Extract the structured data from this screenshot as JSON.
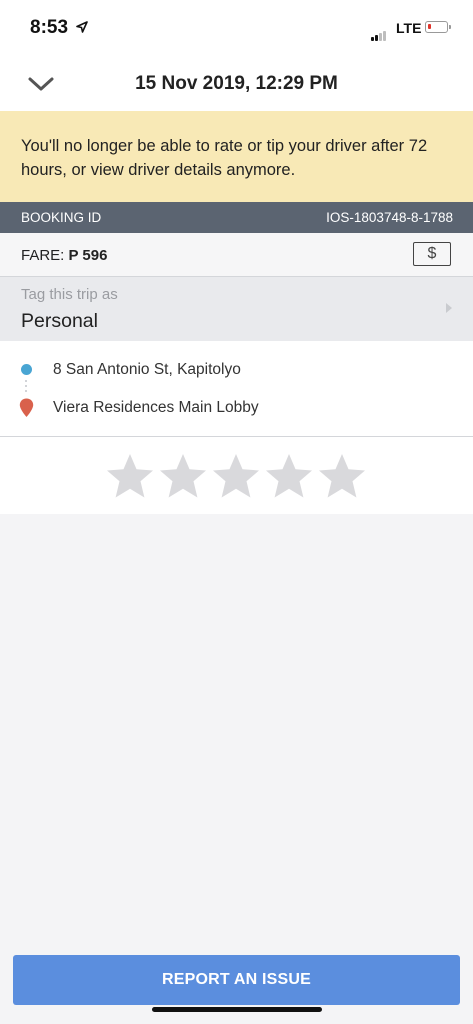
{
  "status_bar": {
    "time": "8:53",
    "network": "LTE",
    "icons": [
      "location-arrow-icon",
      "signal-icon",
      "battery-icon"
    ]
  },
  "header": {
    "title": "15 Nov 2019, 12:29 PM",
    "back_icon": "chevron-down-icon"
  },
  "notice": {
    "text": "You'll no longer be able to rate or tip your driver after 72 hours, or view driver details anymore."
  },
  "booking": {
    "label": "BOOKING ID",
    "id": "IOS-1803748-8-1788"
  },
  "fare": {
    "label": "FARE:",
    "amount": "P 596",
    "receipt_symbol": "$"
  },
  "tag": {
    "hint": "Tag this trip as",
    "value": "Personal",
    "icon": "chevron-right-icon"
  },
  "route": {
    "pickup": "8 San Antonio St, Kapitolyo",
    "dropoff": "Viera Residences Main Lobby"
  },
  "rating": {
    "max_stars": 5,
    "selected": 0
  },
  "actions": {
    "report_label": "REPORT AN ISSUE"
  },
  "colors": {
    "notice_bg": "#f8e9b6",
    "booking_bar": "#5b6471",
    "pickup_dot": "#49a5d3",
    "dropoff_pin": "#d9614c",
    "star_empty": "#d9d9dc",
    "report_button": "#5b8ede"
  }
}
